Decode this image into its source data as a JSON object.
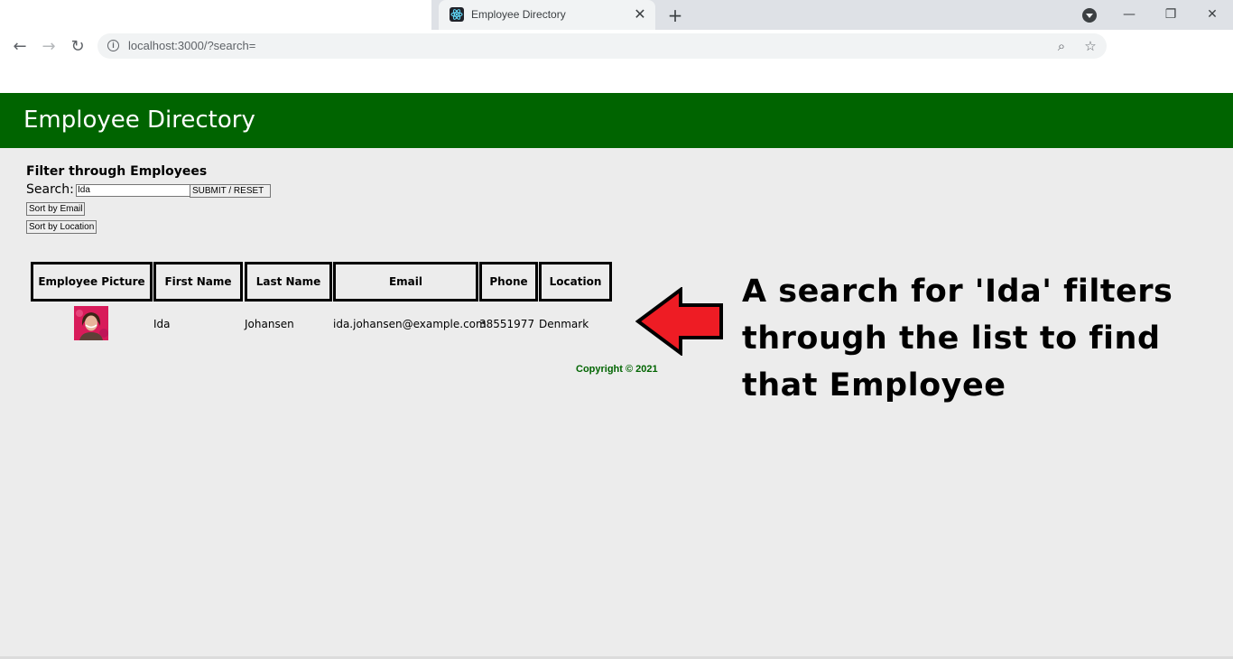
{
  "browser": {
    "tab_title": "Employee Directory",
    "tab_close": "✕",
    "new_tab": "+",
    "window_controls": {
      "minimize": "—",
      "restore": "❐",
      "close": "✕"
    },
    "nav": {
      "back": "←",
      "forward": "→",
      "reload": "↻"
    },
    "url": "localhost:3000/?search=",
    "info_icon": "i",
    "zoom_icon": "⌕",
    "bookmark_icon": "☆"
  },
  "app": {
    "title": "Employee Directory",
    "filter_heading": "Filter through Employees",
    "search_label": "Search:",
    "search_value": "Ida",
    "submit_label": "SUBMIT / RESET",
    "sort_email_label": "Sort by Email",
    "sort_location_label": "Sort by Location"
  },
  "table": {
    "headers": [
      "Employee Picture",
      "First Name",
      "Last Name",
      "Email",
      "Phone",
      "Location"
    ],
    "rows": [
      {
        "first_name": "Ida",
        "last_name": "Johansen",
        "email": "ida.johansen@example.com",
        "phone": "38551977",
        "location": "Denmark"
      }
    ]
  },
  "footer": {
    "copyright": "Copyright © 2021"
  },
  "annotation": {
    "lines": [
      "A search for 'Ida' filters",
      "through the list to find",
      "that Employee"
    ],
    "arrow_color": "#ee1c24"
  },
  "colors": {
    "header_bg": "#006400",
    "page_bg": "#ececec"
  }
}
